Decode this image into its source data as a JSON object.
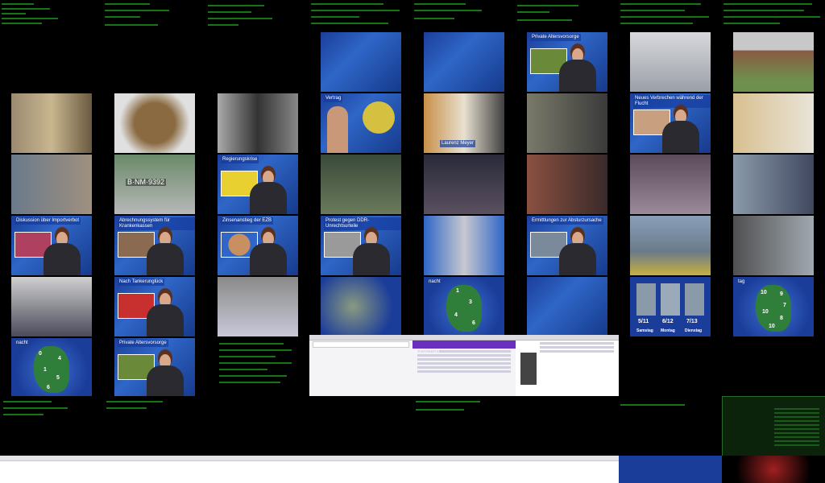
{
  "colors": {
    "terminal_bg": "#000000",
    "terminal_text": "#1a8a1a",
    "news_blue": "#2f66c7",
    "map_green": "#2f7f3a"
  },
  "captions": {
    "private_pension": "Private Altersvorsorge",
    "private_pension_2": "Private Altersvorsorge",
    "new_evidence": "Neues Verbrechen während der Flucht",
    "discussion": "Diskussion über Importverbot",
    "breakdown_system": "Abrechnungssystem für Krankenkassen",
    "government_crisis": "Regierungskrise",
    "interest_rates": "Zinsenanstieg der EZB",
    "protests": "Protest gegen DDR-Unrechtsurteile",
    "investigations": "Ermittlungen zur Absturzursache",
    "after_sinking": "Nach Tankerunglück",
    "sender_label": "Vertrag",
    "name_meyer": "Laurenz Meyer",
    "plate": "B·NM·9392",
    "weather_days": [
      "Samstag",
      "Montag",
      "Dienstag"
    ],
    "weather_temps": [
      "5/11",
      "6/12",
      "7/13"
    ],
    "map_nacht": "nacht",
    "map_tag": "tag"
  },
  "maps": {
    "night_1": [
      "0",
      "4",
      "1",
      "5",
      "6"
    ],
    "night_2": [
      "1",
      "3",
      "4",
      "6"
    ],
    "day": [
      "10",
      "9",
      "7",
      "10",
      "8",
      "10"
    ]
  },
  "browser": {
    "mail_title": "yahoo!mail"
  }
}
